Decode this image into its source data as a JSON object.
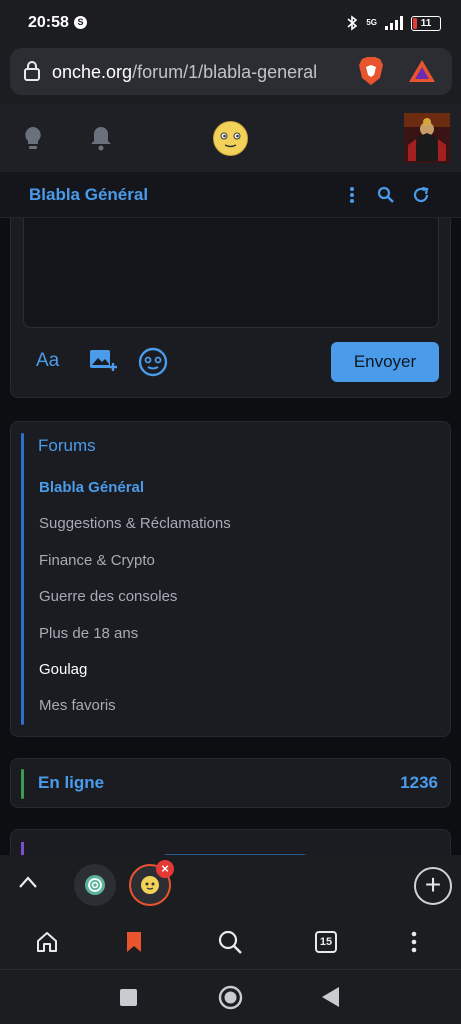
{
  "status_bar": {
    "time": "20:58",
    "status_glyph": "S",
    "network": "5G",
    "battery": "11",
    "icons": [
      "bluetooth-icon",
      "signal-icon",
      "battery-icon"
    ]
  },
  "browser": {
    "url_domain": "onche.org",
    "url_path": "/forum/1/blabla-general",
    "icons": [
      "lock-icon",
      "brave-shield-icon",
      "brave-rewards-icon"
    ]
  },
  "site_header": {
    "icons": [
      "lightbulb-icon",
      "bell-icon",
      "onche-logo-icon",
      "user-avatar"
    ]
  },
  "subbar": {
    "title": "Blabla Général",
    "icons": [
      "more-vert-icon",
      "search-icon",
      "refresh-icon"
    ]
  },
  "composer": {
    "format_label": "Aa",
    "send_label": "Envoyer",
    "icons": [
      "add-image-icon",
      "emoji-icon"
    ]
  },
  "forums": {
    "heading": "Forums",
    "items": [
      {
        "label": "Blabla Général",
        "state": "active"
      },
      {
        "label": "Suggestions & Réclamations",
        "state": "normal"
      },
      {
        "label": "Finance & Crypto",
        "state": "normal"
      },
      {
        "label": "Guerre des consoles",
        "state": "normal"
      },
      {
        "label": "Plus de 18 ans",
        "state": "normal"
      },
      {
        "label": "Goulag",
        "state": "highlight"
      },
      {
        "label": "Mes favoris",
        "state": "normal"
      }
    ]
  },
  "online": {
    "label": "En ligne",
    "count": "1236"
  },
  "tab_strip": {
    "close_glyph": "×",
    "new_tab_glyph": "+"
  },
  "toolbar": {
    "tab_count": "15",
    "icons": [
      "home-icon",
      "bookmark-icon",
      "search-icon",
      "tabs-icon",
      "more-vert-icon"
    ]
  },
  "colors": {
    "accent": "#4a9be9",
    "brave_orange": "#e8542e",
    "online_green": "#3e9a4e"
  }
}
